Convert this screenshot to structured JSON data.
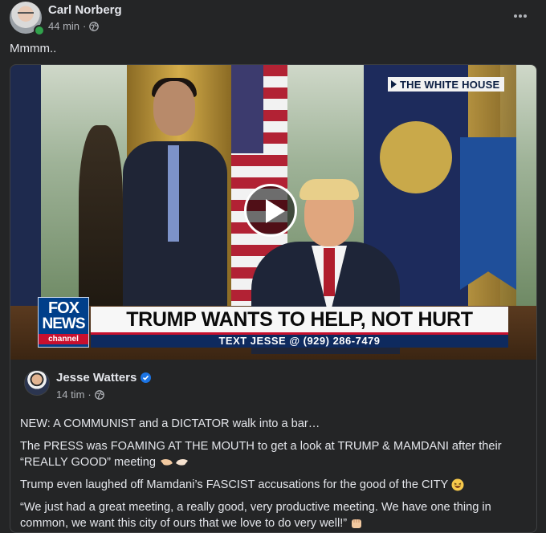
{
  "post": {
    "author": "Carl Norberg",
    "time": "44 min",
    "separator": "·",
    "text": "Mmmm.."
  },
  "video": {
    "bug": "THE WHITE HOUSE",
    "fox_logo": {
      "line1": "FOX",
      "line2": "NEWS",
      "line3": "channel"
    },
    "headline": "TRUMP WANTS TO HELP, NOT HURT",
    "subline": "TEXT JESSE @ (929) 286-7479"
  },
  "embedded": {
    "author": "Jesse Watters",
    "time": "14 tim",
    "separator": "·",
    "paragraphs": [
      "NEW: A COMMUNIST and a DICTATOR walk into a bar…",
      "The PRESS was FOAMING AT THE MOUTH to get a look at TRUMP & MAMDANI after their “REALLY GOOD” meeting",
      "Trump even laughed off Mamdani’s FASCIST accusations for the good of the CITY",
      "“We just had a great meeting, a really good, very productive meeting. We have one thing in common, we want this city of ours that we love to do very well!”"
    ],
    "icons": [
      "handshake-emoji",
      "laughing-emoji",
      "fist-emoji"
    ]
  },
  "colors": {
    "background": "#242526",
    "text": "#e4e6eb",
    "secondary_text": "#b0b3b8",
    "online": "#31a24c",
    "verified": "#1b74e4"
  }
}
